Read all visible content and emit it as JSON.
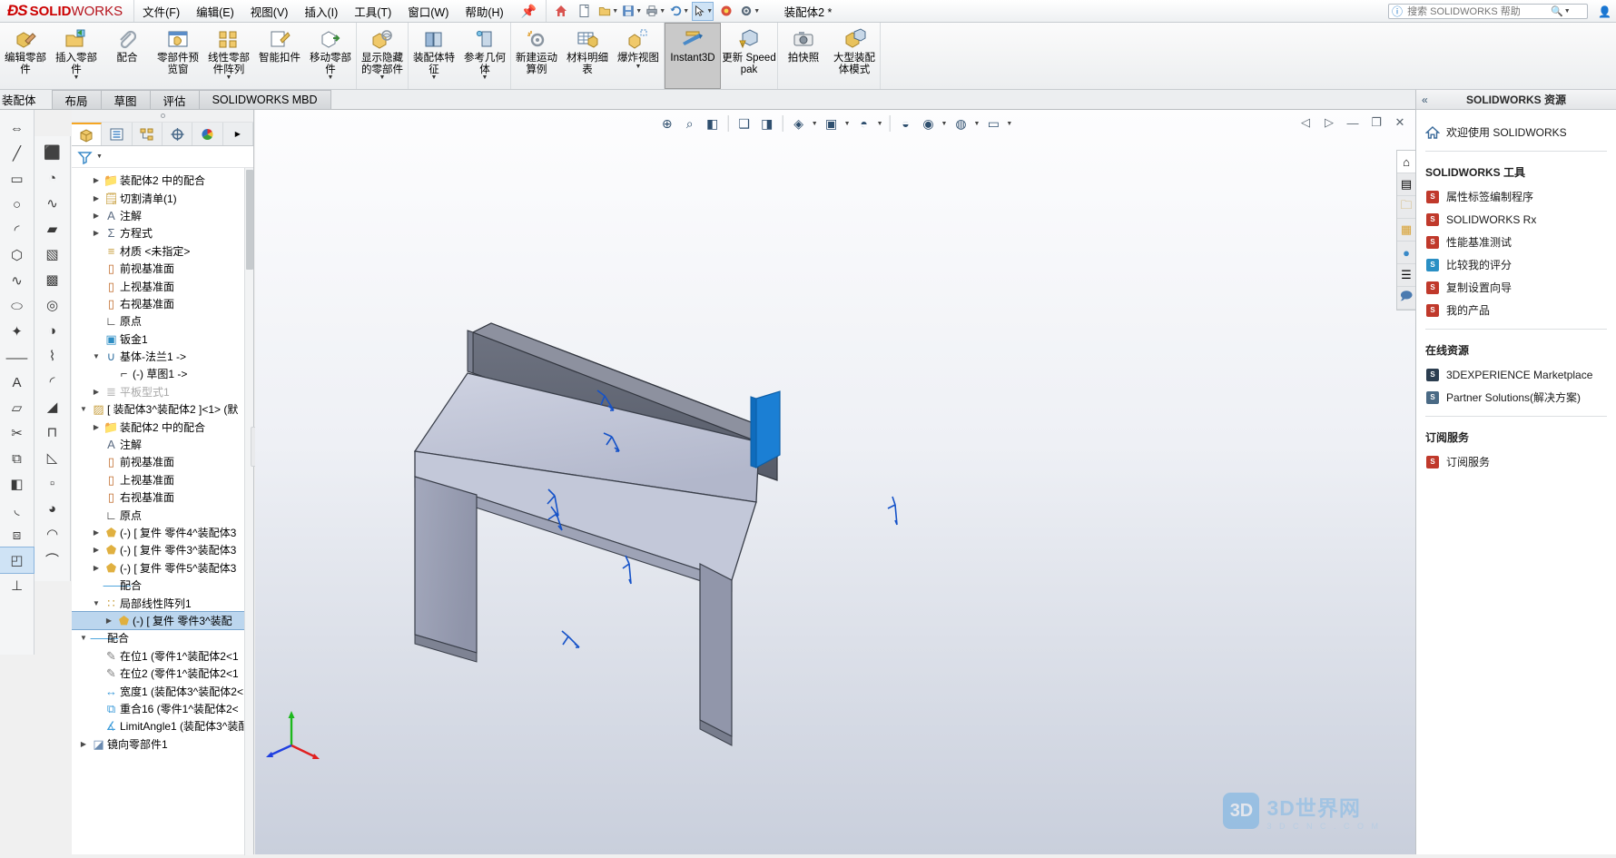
{
  "app": {
    "brand_ds": "ưS",
    "brand_solid": "SOLID",
    "brand_works": "WORKS",
    "document_title": "装配体2 *"
  },
  "menubar": {
    "items": [
      {
        "label": "文件(F)",
        "name": "menu-file"
      },
      {
        "label": "编辑(E)",
        "name": "menu-edit"
      },
      {
        "label": "视图(V)",
        "name": "menu-view"
      },
      {
        "label": "插入(I)",
        "name": "menu-insert"
      },
      {
        "label": "工具(T)",
        "name": "menu-tools"
      },
      {
        "label": "窗口(W)",
        "name": "menu-window"
      },
      {
        "label": "帮助(H)",
        "name": "menu-help"
      }
    ],
    "pin_icon": "pin-icon"
  },
  "quick_access": [
    {
      "name": "home-button",
      "glyph": "⌂",
      "dropdown": false
    },
    {
      "name": "new-document-button",
      "glyph": "὜B",
      "dropdown": false
    },
    {
      "name": "open-document-button",
      "glyph": "Ὄ1",
      "dropdown": true
    },
    {
      "name": "save-button",
      "glyph": "ὋE",
      "dropdown": true
    },
    {
      "name": "print-button",
      "glyph": "὚8",
      "dropdown": true
    },
    {
      "name": "undo-button",
      "glyph": "↶",
      "dropdown": true
    },
    {
      "name": "select-button",
      "glyph": "↖",
      "dropdown": true,
      "selected": true
    },
    {
      "name": "rebuild-button",
      "glyph": "◐",
      "dropdown": false
    },
    {
      "name": "options-button",
      "glyph": "⚙",
      "dropdown": true
    }
  ],
  "search": {
    "placeholder": "搜索 SOLIDWORKS 帮助",
    "value": "",
    "help_icon": "help-icon",
    "magnifier_icon": "search-icon"
  },
  "ribbon": {
    "groups": [
      {
        "name": "group-components",
        "buttons": [
          {
            "name": "edit-component-button",
            "label": "编辑零部件",
            "icon": "edit-part-icon",
            "dropdown": false
          },
          {
            "name": "insert-component-button",
            "label": "插入零部件",
            "icon": "insert-part-icon",
            "dropdown": true
          },
          {
            "name": "mate-button",
            "label": "配合",
            "icon": "paperclip-icon",
            "dropdown": false
          },
          {
            "name": "component-preview-window-button",
            "label": "零部件预览窗",
            "icon": "preview-window-icon",
            "dropdown": false
          },
          {
            "name": "linear-component-pattern-button",
            "label": "线性零部件阵列",
            "icon": "pattern-icon",
            "dropdown": true
          },
          {
            "name": "smart-fasteners-button",
            "label": "智能扣件",
            "icon": "smart-fastener-icon",
            "dropdown": false
          },
          {
            "name": "move-component-button",
            "label": "移动零部件",
            "icon": "move-part-icon",
            "dropdown": true
          }
        ]
      },
      {
        "name": "group-display",
        "buttons": [
          {
            "name": "show-hidden-components-button",
            "label": "显示隐藏的零部件",
            "icon": "show-hidden-icon",
            "dropdown": true
          }
        ]
      },
      {
        "name": "group-features",
        "buttons": [
          {
            "name": "assembly-features-button",
            "label": "装配体特征",
            "icon": "assembly-feature-icon",
            "dropdown": true
          },
          {
            "name": "reference-geometry-button",
            "label": "参考几何体",
            "icon": "reference-geometry-icon",
            "dropdown": true
          }
        ]
      },
      {
        "name": "group-motion",
        "buttons": [
          {
            "name": "new-motion-study-button",
            "label": "新建运动算例",
            "icon": "motion-study-icon",
            "dropdown": false
          },
          {
            "name": "bill-of-materials-button",
            "label": "材料明细表",
            "icon": "bom-icon",
            "dropdown": false
          },
          {
            "name": "exploded-view-button",
            "label": "爆炸视图",
            "icon": "exploded-view-icon",
            "dropdown": true
          }
        ]
      },
      {
        "name": "group-instant3d",
        "buttons": [
          {
            "name": "instant3d-button",
            "label": "Instant3D",
            "icon": "instant3d-icon",
            "dropdown": false,
            "active": true
          },
          {
            "name": "update-speedpak-button",
            "label": "更新 Speedpak",
            "icon": "update-speedpak-icon",
            "dropdown": false
          }
        ]
      },
      {
        "name": "group-snapshot",
        "buttons": [
          {
            "name": "take-snapshot-button",
            "label": "拍快照",
            "icon": "camera-icon",
            "dropdown": false
          },
          {
            "name": "large-assembly-mode-button",
            "label": "大型装配体模式",
            "icon": "large-assembly-icon",
            "dropdown": false
          }
        ]
      }
    ]
  },
  "command_tabs": [
    {
      "label": "装配体",
      "name": "tab-assembly",
      "selected": true,
      "first": true
    },
    {
      "label": "布局",
      "name": "tab-layout",
      "selected": false
    },
    {
      "label": "草图",
      "name": "tab-sketch",
      "selected": false
    },
    {
      "label": "评估",
      "name": "tab-evaluate",
      "selected": false
    },
    {
      "label": "SOLIDWORKS MBD",
      "name": "tab-solidworks-mbd",
      "selected": false
    }
  ],
  "left_toolbar_primary": [
    {
      "name": "dimension-tool-icon",
      "glyph": "⇔",
      "dropdown": true
    },
    {
      "name": "line-tool-icon",
      "glyph": "╱",
      "dropdown": true
    },
    {
      "name": "rectangle-tool-icon",
      "glyph": "▭",
      "dropdown": true
    },
    {
      "name": "circle-tool-icon",
      "glyph": "○",
      "dropdown": true
    },
    {
      "name": "arc-tool-icon",
      "glyph": "◜",
      "dropdown": true
    },
    {
      "name": "polygon-tool-icon",
      "glyph": "⬡",
      "dropdown": true
    },
    {
      "name": "spline-tool-icon",
      "glyph": "∿",
      "dropdown": true
    },
    {
      "name": "ellipse-tool-icon",
      "glyph": "⬭",
      "dropdown": true
    },
    {
      "name": "point-tool-icon",
      "glyph": "✦",
      "dropdown": false
    },
    {
      "name": "centerline-tool-icon",
      "glyph": "⸺",
      "dropdown": false
    },
    {
      "name": "text-tool-icon",
      "glyph": "A",
      "dropdown": false
    },
    {
      "name": "plane-tool-icon",
      "glyph": "▱",
      "dropdown": false
    },
    {
      "name": "trim-tool-icon",
      "glyph": "✂",
      "dropdown": false
    },
    {
      "name": "offset-tool-icon",
      "glyph": "⧉",
      "dropdown": false
    },
    {
      "name": "mirror-tool-icon",
      "glyph": "◧",
      "dropdown": false
    },
    {
      "name": "fillet-tool-icon",
      "glyph": "◟",
      "dropdown": false
    },
    {
      "name": "convert-entities-icon",
      "glyph": "⧈",
      "dropdown": false
    },
    {
      "name": "sheetmetal-tool-icon",
      "glyph": "◰",
      "dropdown": false,
      "selected": true
    },
    {
      "name": "relations-tool-icon",
      "glyph": "⊥",
      "dropdown": false
    }
  ],
  "left_toolbar_secondary": [
    {
      "name": "extrude-boss-icon",
      "glyph": "⬛"
    },
    {
      "name": "revolve-boss-icon",
      "glyph": "◔"
    },
    {
      "name": "swept-boss-icon",
      "glyph": "∿"
    },
    {
      "name": "lofted-boss-icon",
      "glyph": "▰"
    },
    {
      "name": "boundary-boss-icon",
      "glyph": "▧"
    },
    {
      "name": "extrude-cut-icon",
      "glyph": "▩"
    },
    {
      "name": "hole-wizard-icon",
      "glyph": "◎"
    },
    {
      "name": "revolve-cut-icon",
      "glyph": "◑"
    },
    {
      "name": "swept-cut-icon",
      "glyph": "⌇"
    },
    {
      "name": "fillet-feature-icon",
      "glyph": "◜"
    },
    {
      "name": "chamfer-feature-icon",
      "glyph": "◢"
    },
    {
      "name": "rib-feature-icon",
      "glyph": "⊓"
    },
    {
      "name": "draft-feature-icon",
      "glyph": "◺"
    },
    {
      "name": "shell-feature-icon",
      "glyph": "▫"
    },
    {
      "name": "wrap-feature-icon",
      "glyph": "◕"
    },
    {
      "name": "dome-feature-icon",
      "glyph": "◠"
    },
    {
      "name": "curve-feature-icon",
      "glyph": "⌒"
    }
  ],
  "tree_panel": {
    "tabs": [
      {
        "name": "feature-manager-tab",
        "icon": "solidworks-cube-icon",
        "selected": true
      },
      {
        "name": "property-manager-tab",
        "icon": "property-list-icon",
        "selected": false
      },
      {
        "name": "configuration-manager-tab",
        "icon": "configuration-icon",
        "selected": false
      },
      {
        "name": "dimxpert-manager-tab",
        "icon": "dimxpert-icon",
        "selected": false
      },
      {
        "name": "display-manager-tab",
        "icon": "display-palette-icon",
        "selected": false
      }
    ],
    "filter_icon": "filter-icon",
    "items": [
      {
        "depth": 1,
        "arrow": "closed",
        "icon": "mate-folder-icon",
        "label": "装配体2 中的配合",
        "color": "#8a8a8a",
        "state": "normal"
      },
      {
        "depth": 1,
        "arrow": "closed",
        "icon": "cutlist-icon",
        "label": "切割清单(1)",
        "color": "#c8a040",
        "state": "normal"
      },
      {
        "depth": 1,
        "arrow": "closed",
        "icon": "annotation-icon",
        "label": "注解",
        "color": "#5a6a80",
        "state": "normal"
      },
      {
        "depth": 1,
        "arrow": "closed",
        "icon": "equations-icon",
        "label": "方程式",
        "color": "#5a6a80",
        "state": "normal"
      },
      {
        "depth": 1,
        "arrow": "none",
        "icon": "material-icon",
        "label": "材质 <未指定>",
        "color": "#c8a040",
        "state": "normal"
      },
      {
        "depth": 1,
        "arrow": "none",
        "icon": "plane-icon",
        "label": "前视基准面",
        "color": "#c06a2a",
        "state": "normal"
      },
      {
        "depth": 1,
        "arrow": "none",
        "icon": "plane-icon",
        "label": "上视基准面",
        "color": "#c06a2a",
        "state": "normal"
      },
      {
        "depth": 1,
        "arrow": "none",
        "icon": "plane-icon",
        "label": "右视基准面",
        "color": "#c06a2a",
        "state": "normal"
      },
      {
        "depth": 1,
        "arrow": "none",
        "icon": "origin-icon",
        "label": "原点",
        "color": "#222",
        "state": "normal"
      },
      {
        "depth": 1,
        "arrow": "none",
        "icon": "sheetmetal-icon",
        "label": "钣金1",
        "color": "#2f8ec4",
        "state": "normal"
      },
      {
        "depth": 1,
        "arrow": "open",
        "icon": "base-flange-icon",
        "label": "基体-法兰1 ->",
        "color": "#2f6fa0",
        "state": "normal"
      },
      {
        "depth": 2,
        "arrow": "none",
        "icon": "sketch-icon",
        "label": "(-) 草图1 ->",
        "color": "#333",
        "state": "normal"
      },
      {
        "depth": 1,
        "arrow": "closed",
        "icon": "flat-pattern-icon",
        "label": "平板型式1",
        "color": "#b8b8b8",
        "state": "dim"
      },
      {
        "depth": 0,
        "arrow": "open",
        "icon": "assembly-icon",
        "label": "[ 装配体3^装配体2 ]<1> (默",
        "color": "#c8a040",
        "state": "normal"
      },
      {
        "depth": 1,
        "arrow": "closed",
        "icon": "mate-folder-icon",
        "label": "装配体2 中的配合",
        "color": "#8a8a8a",
        "state": "normal"
      },
      {
        "depth": 1,
        "arrow": "none",
        "icon": "annotation-icon",
        "label": "注解",
        "color": "#5a6a80",
        "state": "normal"
      },
      {
        "depth": 1,
        "arrow": "none",
        "icon": "plane-icon",
        "label": "前视基准面",
        "color": "#c06a2a",
        "state": "normal"
      },
      {
        "depth": 1,
        "arrow": "none",
        "icon": "plane-icon",
        "label": "上视基准面",
        "color": "#c06a2a",
        "state": "normal"
      },
      {
        "depth": 1,
        "arrow": "none",
        "icon": "plane-icon",
        "label": "右视基准面",
        "color": "#c06a2a",
        "state": "normal"
      },
      {
        "depth": 1,
        "arrow": "none",
        "icon": "origin-icon",
        "label": "原点",
        "color": "#222",
        "state": "normal"
      },
      {
        "depth": 1,
        "arrow": "closed",
        "icon": "part-icon",
        "label": "(-) [ 复件 零件4^装配体3",
        "color": "#e0b040",
        "state": "normal"
      },
      {
        "depth": 1,
        "arrow": "closed",
        "icon": "part-icon",
        "label": "(-) [ 复件 零件3^装配体3",
        "color": "#e0b040",
        "state": "normal"
      },
      {
        "depth": 1,
        "arrow": "closed",
        "icon": "part-icon",
        "label": "(-) [ 复件 零件5^装配体3",
        "color": "#e0b040",
        "state": "normal"
      },
      {
        "depth": 1,
        "arrow": "none",
        "icon": "mates-icon",
        "label": "配合",
        "color": "#3a9ad9",
        "state": "normal"
      },
      {
        "depth": 1,
        "arrow": "open",
        "icon": "local-pattern-icon",
        "label": "局部线性阵列1",
        "color": "#c8a040",
        "state": "normal"
      },
      {
        "depth": 2,
        "arrow": "closed",
        "icon": "part-icon",
        "label": "(-) [ 复件 零件3^装配",
        "color": "#e0b040",
        "state": "selected"
      },
      {
        "depth": 0,
        "arrow": "open",
        "icon": "mates-icon",
        "label": "配合",
        "color": "#3a9ad9",
        "state": "normal"
      },
      {
        "depth": 1,
        "arrow": "none",
        "icon": "inplace-mate-icon",
        "label": "在位1 (零件1^装配体2<1",
        "color": "#7a7a7a",
        "state": "normal"
      },
      {
        "depth": 1,
        "arrow": "none",
        "icon": "inplace-mate-icon",
        "label": "在位2 (零件1^装配体2<1",
        "color": "#7a7a7a",
        "state": "normal"
      },
      {
        "depth": 1,
        "arrow": "none",
        "icon": "width-mate-icon",
        "label": "宽度1 (装配体3^装配体2<",
        "color": "#3a9ad9",
        "state": "normal"
      },
      {
        "depth": 1,
        "arrow": "none",
        "icon": "coincident-mate-icon",
        "label": "重合16 (零件1^装配体2<",
        "color": "#3a9ad9",
        "state": "normal"
      },
      {
        "depth": 1,
        "arrow": "none",
        "icon": "angle-mate-icon",
        "label": "LimitAngle1 (装配体3^装配",
        "color": "#3a9ad9",
        "state": "normal"
      },
      {
        "depth": 0,
        "arrow": "closed",
        "icon": "mirror-components-icon",
        "label": "镜向零部件1",
        "color": "#6a8ab0",
        "state": "normal"
      }
    ]
  },
  "graphics_toolbar": [
    {
      "name": "zoom-to-fit-icon",
      "glyph": "⊕"
    },
    {
      "name": "zoom-to-area-icon",
      "glyph": "⌕"
    },
    {
      "name": "section-view-icon",
      "glyph": "◧"
    },
    {
      "name": "view-orientation-icon",
      "glyph": "❑"
    },
    {
      "name": "display-style-icon",
      "glyph": "◨"
    },
    {
      "name": "hide-show-items-icon",
      "glyph": "◈",
      "dropdown": true
    },
    {
      "name": "edit-appearance-icon",
      "glyph": "▣",
      "dropdown": true
    },
    {
      "name": "apply-scene-icon",
      "glyph": "◓",
      "dropdown": true
    },
    {
      "name": "view-settings-icon",
      "glyph": "◒"
    },
    {
      "name": "appearances-icon",
      "glyph": "◉",
      "dropdown": true
    },
    {
      "name": "scene-icon",
      "glyph": "◍",
      "dropdown": true
    },
    {
      "name": "viewport-icon",
      "glyph": "▭",
      "dropdown": true
    }
  ],
  "graphics_window_controls": [
    {
      "name": "restore-previous-window-button",
      "glyph": "◁"
    },
    {
      "name": "restore-next-window-button",
      "glyph": "▷"
    },
    {
      "name": "minimize-window-button",
      "glyph": "—"
    },
    {
      "name": "maximize-window-button",
      "glyph": "❐"
    },
    {
      "name": "close-window-button",
      "glyph": "✕"
    }
  ],
  "model": {
    "description": "钣金桌子装配体 等轴测视图",
    "selected_face_color": "#1b7fd4",
    "body_color": "#b9bdd0",
    "top_face_color": "#c7cbdc",
    "edge_color": "#3a3f4a"
  },
  "watermark": {
    "cube_label": "3D",
    "title": "3D世界网",
    "subtitle": "3 D C N C . C O M"
  },
  "right_rail": [
    {
      "name": "rail-solidworks-resources-tab",
      "icon": "home-icon",
      "selected": true
    },
    {
      "name": "rail-design-library-tab",
      "icon": "library-icon",
      "selected": false
    },
    {
      "name": "rail-file-explorer-tab",
      "icon": "folder-icon",
      "selected": false
    },
    {
      "name": "rail-view-palette-tab",
      "icon": "view-palette-icon",
      "selected": false
    },
    {
      "name": "rail-appearances-tab",
      "icon": "appearance-sphere-icon",
      "selected": false
    },
    {
      "name": "rail-custom-properties-tab",
      "icon": "custom-properties-icon",
      "selected": false
    },
    {
      "name": "rail-forum-tab",
      "icon": "forum-icon",
      "selected": false
    }
  ],
  "task_pane": {
    "title": "SOLIDWORKS 资源",
    "collapse_icon": "double-chevron-left-icon",
    "welcome": {
      "label": "欢迎使用 SOLIDWORKS",
      "icon": "home-icon"
    },
    "sections": [
      {
        "heading": "SOLIDWORKS 工具",
        "name": "section-solidworks-tools",
        "links": [
          {
            "label": "属性标签编制程序",
            "icon": "property-tab-builder-icon",
            "color": "#c0392b"
          },
          {
            "label": "SOLIDWORKS Rx",
            "icon": "solidworks-rx-icon",
            "color": "#c0392b"
          },
          {
            "label": "性能基准测试",
            "icon": "performance-benchmark-icon",
            "color": "#c0392b"
          },
          {
            "label": "比较我的评分",
            "icon": "compare-score-icon",
            "color": "#2a8fc4"
          },
          {
            "label": "复制设置向导",
            "icon": "copy-settings-wizard-icon",
            "color": "#c0392b"
          },
          {
            "label": "我的产品",
            "icon": "my-products-icon",
            "color": "#c0392b"
          }
        ]
      },
      {
        "heading": "在线资源",
        "name": "section-online-resources",
        "links": [
          {
            "label": "3DEXPERIENCE Marketplace",
            "icon": "marketplace-icon",
            "color": "#2c3e50"
          },
          {
            "label": "Partner Solutions(解决方案)",
            "icon": "partner-solutions-icon",
            "color": "#4a6a85"
          }
        ]
      },
      {
        "heading": "订阅服务",
        "name": "section-subscription-services",
        "links": [
          {
            "label": "订阅服务",
            "icon": "subscription-icon",
            "color": "#c0392b"
          }
        ]
      }
    ]
  }
}
